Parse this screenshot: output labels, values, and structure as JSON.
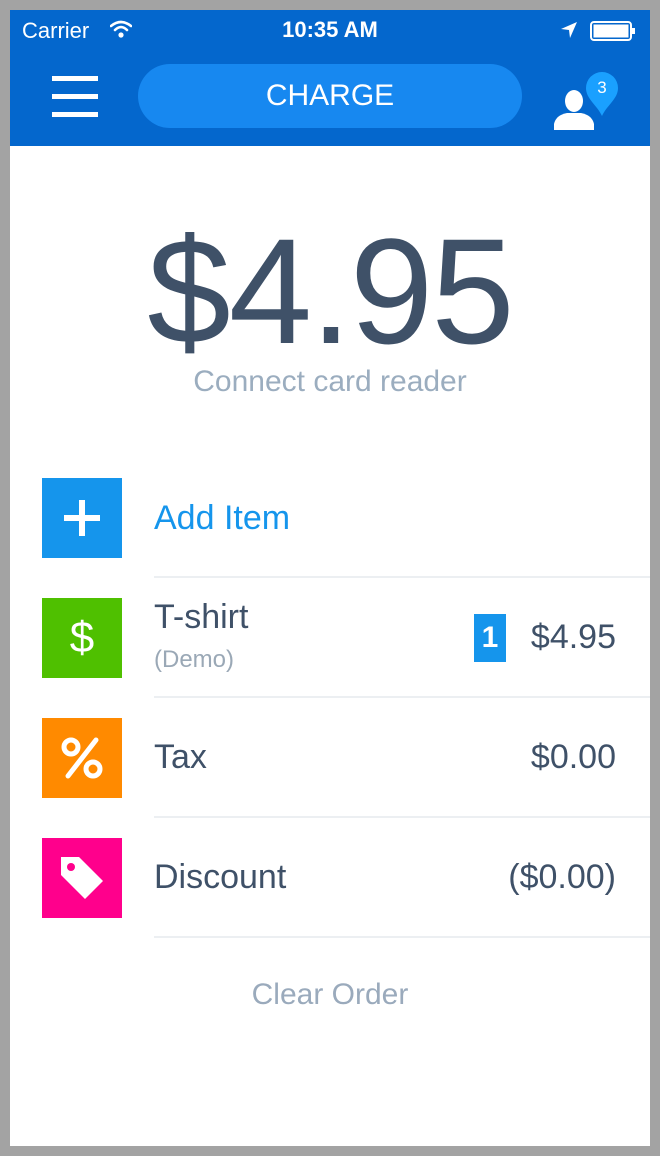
{
  "status_bar": {
    "carrier": "Carrier",
    "time": "10:35 AM"
  },
  "header": {
    "charge_label": "CHARGE",
    "customers_badge": "3"
  },
  "amount": {
    "total": "$4.95",
    "reader_prompt": "Connect card reader"
  },
  "order": {
    "add_item_label": "Add Item",
    "items": [
      {
        "name": "T-shirt",
        "note": "(Demo)",
        "quantity": "1",
        "price": "$4.95"
      }
    ],
    "tax": {
      "label": "Tax",
      "value": "$0.00"
    },
    "discount": {
      "label": "Discount",
      "value": "($0.00)"
    },
    "clear_label": "Clear Order"
  },
  "colors": {
    "header": "#0467cd",
    "charge_button": "#1788f0",
    "add_item": "#1595ec",
    "item_tile": "#4fc000",
    "tax_tile": "#ff8a00",
    "discount_tile": "#ff008c",
    "text_primary": "#3f5168"
  },
  "icons": {
    "menu": "hamburger-icon",
    "customers": "person-icon",
    "add": "plus-icon",
    "item": "dollar-icon",
    "tax": "percent-icon",
    "discount": "tag-icon"
  }
}
